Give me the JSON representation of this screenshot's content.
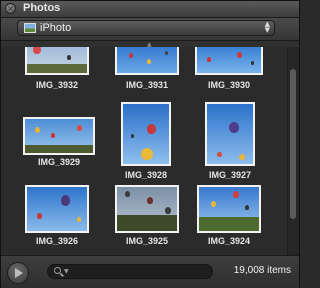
{
  "window": {
    "title": "Photos"
  },
  "source": {
    "selected": "iPhoto"
  },
  "photos": [
    {
      "label": "IMG_3932"
    },
    {
      "label": "IMG_3931"
    },
    {
      "label": "IMG_3930"
    },
    {
      "label": "IMG_3929"
    },
    {
      "label": "IMG_3928"
    },
    {
      "label": "IMG_3927"
    },
    {
      "label": "IMG_3926"
    },
    {
      "label": "IMG_3925"
    },
    {
      "label": "IMG_3924"
    }
  ],
  "search": {
    "value": "",
    "placeholder": ""
  },
  "status": {
    "item_count": "19,008 items"
  },
  "colors": {
    "sky": "#3f86d6",
    "sky_light": "#8fc0ee",
    "frame": "#f2f2f2",
    "panel": "#303030"
  },
  "icons": {
    "close": "close-icon",
    "source": "iphoto-icon",
    "play": "play-icon",
    "search": "search-icon"
  }
}
